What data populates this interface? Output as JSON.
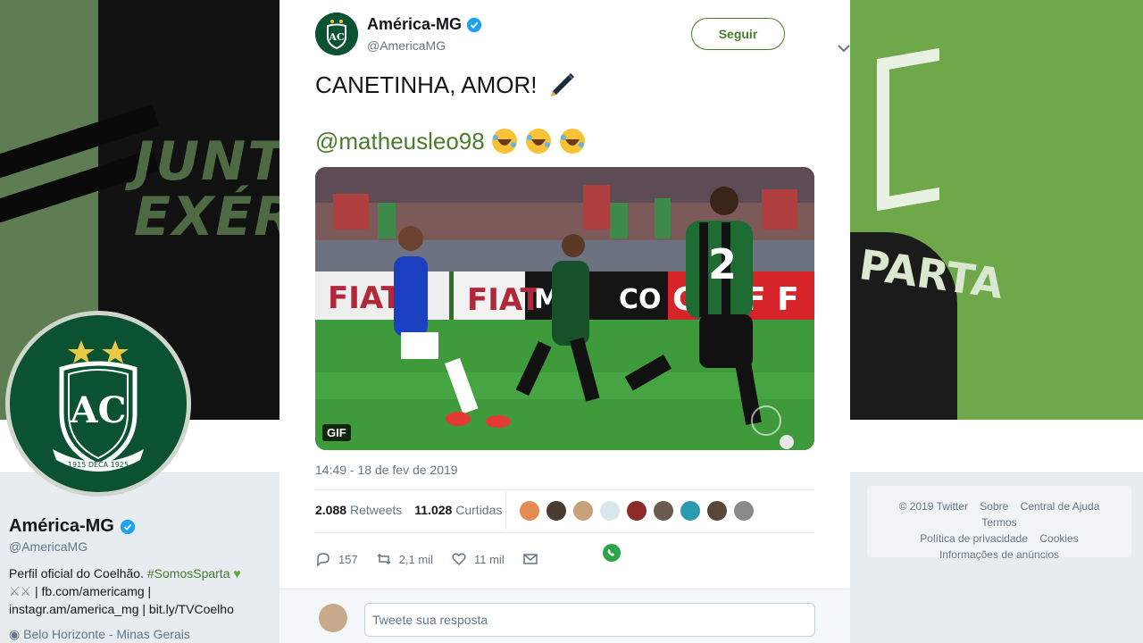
{
  "background_profile": {
    "banner_slogan_line1": "JUNTE",
    "banner_slogan_line2": "EXÉR",
    "shirt_brand": "PARTA",
    "name": "América-MG",
    "handle": "@AmericaMG",
    "bio_text": "Perfil oficial do Coelhão.",
    "bio_hashtag": "#SomosSparta",
    "bio_line2": "| fb.com/americamg |",
    "bio_line3": "instagr.am/america_mg | bit.ly/TVCoelho",
    "location": "Belo Horizonte - Minas Gerais",
    "avatar_ring_text": "1915 DECA 1925"
  },
  "footer": {
    "copyright": "© 2019 Twitter",
    "links": [
      "Sobre",
      "Central de Ajuda",
      "Termos",
      "Política de privacidade",
      "Cookies",
      "Informações de anúncios"
    ]
  },
  "tweet": {
    "author_name": "América-MG",
    "author_handle": "@AmericaMG",
    "follow_label": "Seguir",
    "text_line1": "CANETINHA, AMOR!",
    "mention": "@matheusleo98",
    "media": {
      "gif_badge": "GIF",
      "ads": [
        "FIAT",
        "FIAT",
        "M",
        "CO",
        "G",
        "F F"
      ],
      "player_number": "2"
    },
    "timestamp": "14:49 - 18 de fev de 2019",
    "retweets_count": "2.088",
    "retweets_label": "Retweets",
    "likes_count": "11.028",
    "likes_label": "Curtidas",
    "reply_count": "157",
    "retweet_action_count": "2,1 mil",
    "like_action_count": "11 mil"
  },
  "reply": {
    "placeholder": "Tweete sua resposta"
  },
  "colors": {
    "accent_green": "#4c7b2d",
    "club_green": "#0a5231",
    "verified_blue": "#1da1f2"
  }
}
